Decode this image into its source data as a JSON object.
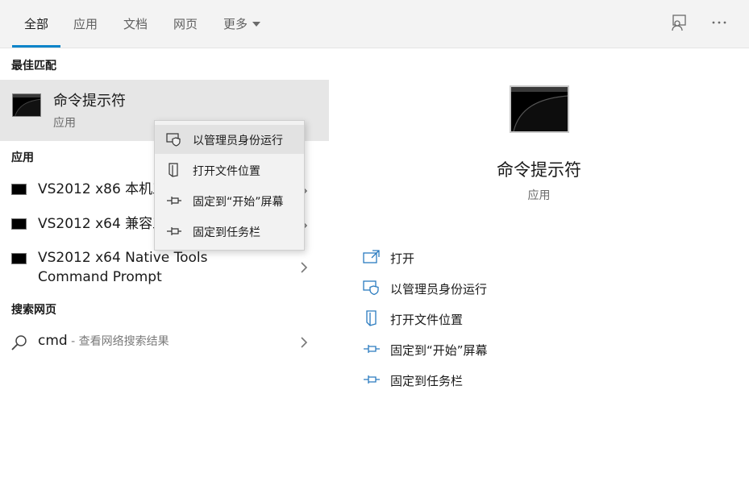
{
  "tabs": [
    {
      "label": "全部",
      "active": true
    },
    {
      "label": "应用",
      "active": false
    },
    {
      "label": "文档",
      "active": false
    },
    {
      "label": "网页",
      "active": false
    },
    {
      "label": "更多",
      "active": false
    }
  ],
  "top_icons": [
    "feedback-icon",
    "more-options-icon"
  ],
  "accent_color": "#0a84c9",
  "best_match": {
    "section_title": "最佳匹配",
    "name": "命令提示符",
    "type": "应用",
    "icon": "command-prompt-icon"
  },
  "apps": {
    "section_title": "应用",
    "items": [
      {
        "label": "VS2012 x86 本机工具命令提示",
        "icon": "command-prompt-icon"
      },
      {
        "label": "VS2012 x64 兼容工具命令提示",
        "icon": "command-prompt-icon"
      },
      {
        "label_line1": "VS2012 x64 Native Tools",
        "label_line2": "Command Prompt",
        "icon": "command-prompt-icon"
      }
    ]
  },
  "web": {
    "section_title": "搜索网页",
    "term": "cmd",
    "hint": " - 查看网络搜索结果",
    "icon": "search-icon"
  },
  "context_menu": {
    "items": [
      {
        "label": "以管理员身份运行",
        "icon": "admin-shield-icon"
      },
      {
        "label": "打开文件位置",
        "icon": "file-location-icon"
      },
      {
        "label": "固定到“开始”屏幕",
        "icon": "pin-icon"
      },
      {
        "label": "固定到任务栏",
        "icon": "pin-icon"
      }
    ]
  },
  "preview": {
    "title": "命令提示符",
    "subtitle": "应用",
    "icon": "command-prompt-icon",
    "actions": [
      {
        "label": "打开",
        "icon": "open-icon"
      },
      {
        "label": "以管理员身份运行",
        "icon": "admin-shield-icon"
      },
      {
        "label": "打开文件位置",
        "icon": "file-location-icon"
      },
      {
        "label": "固定到“开始”屏幕",
        "icon": "pin-icon"
      },
      {
        "label": "固定到任务栏",
        "icon": "pin-icon"
      }
    ]
  }
}
